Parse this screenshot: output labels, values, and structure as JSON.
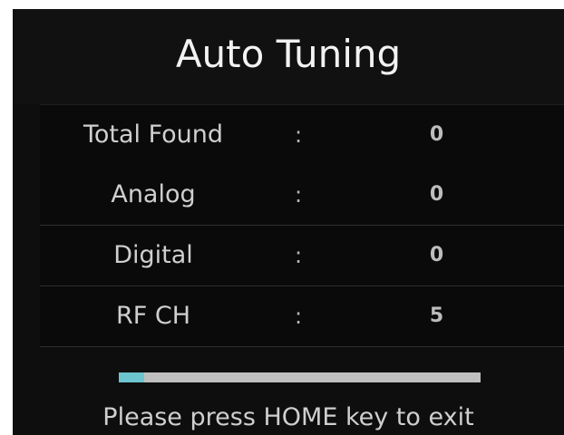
{
  "title": "Auto Tuning",
  "rows": [
    {
      "label": "Total Found",
      "separator": ":",
      "value": "0"
    },
    {
      "label": "Analog",
      "separator": ":",
      "value": "0"
    },
    {
      "label": "Digital",
      "separator": ":",
      "value": "0"
    },
    {
      "label": "RF CH",
      "separator": ":",
      "value": "5"
    }
  ],
  "progress": {
    "fraction": 0.07,
    "fill_color": "#6cc5cf",
    "track_color": "#bfbfbf"
  },
  "hint": "Please press HOME key to exit"
}
